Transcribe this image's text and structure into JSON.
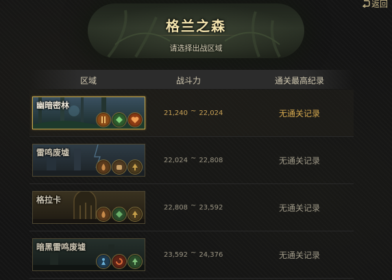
{
  "top_bar": {
    "back_label": "返回"
  },
  "header": {
    "title": "格兰之森",
    "subtitle": "请选择出战区域"
  },
  "columns": [
    "区域",
    "战斗力",
    "通关最高纪录"
  ],
  "colors": {
    "accent_gold": "#c9a94d",
    "power_selected": "#c9a256",
    "record_selected": "#d6a94e"
  },
  "dungeons": [
    {
      "name": "幽暗密林",
      "power_min": "21,240",
      "power_max": "22,024",
      "record": "无通关记录",
      "selected": true,
      "badges": [
        "tall-pillar-icon",
        "green-shell-icon",
        "heart-icon"
      ]
    },
    {
      "name": "雷鸣废墟",
      "power_min": "22,024",
      "power_max": "22,808",
      "record": "无通关记录",
      "selected": false,
      "badges": [
        "flame-icon",
        "fist-icon",
        "spade-icon"
      ]
    },
    {
      "name": "格拉卡",
      "power_min": "22,808",
      "power_max": "23,592",
      "record": "无通关记录",
      "selected": false,
      "badges": [
        "flame-icon",
        "green-shell-icon",
        "spade-icon"
      ]
    },
    {
      "name": "暗黑雷鸣废墟",
      "power_min": "23,592",
      "power_max": "24,376",
      "record": "无通关记录",
      "selected": false,
      "badges": [
        "blue-figure-icon",
        "red-swirl-icon",
        "spade-icon"
      ]
    }
  ]
}
